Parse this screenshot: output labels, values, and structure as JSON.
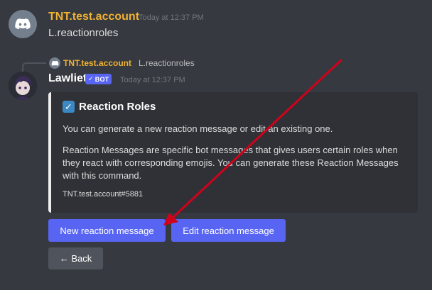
{
  "messages": [
    {
      "username": "TNT.test.account",
      "timestamp": "Today at 12:37 PM",
      "content": "L.reactionroles",
      "username_color": "#f0b232"
    }
  ],
  "reply": {
    "username": "TNT.test.account",
    "content": "L.reactionroles"
  },
  "bot_message": {
    "username": "Lawliet",
    "bot_tag": "BOT",
    "timestamp": "Today at 12:37 PM",
    "embed": {
      "title": "Reaction Roles",
      "description_1": "You can generate a new reaction message or edit an existing one.",
      "description_2": "Reaction Messages are specific bot messages that gives users certain roles when they react with corresponding emojis. You can generate these Reaction Messages with this command.",
      "footer": "TNT.test.account#5881",
      "border_color": "#eeeeee"
    },
    "buttons": {
      "new_label": "New reaction message",
      "edit_label": "Edit reaction message",
      "back_label": "← Back"
    }
  },
  "colors": {
    "background": "#36393f",
    "blurple": "#5865f2",
    "secondary_button": "#4f545c",
    "arrow": "#d0021b"
  },
  "icons": {
    "discord_avatar": "discord-logo-icon",
    "checkbox": "checkmark-box-icon",
    "verified": "check-icon"
  }
}
